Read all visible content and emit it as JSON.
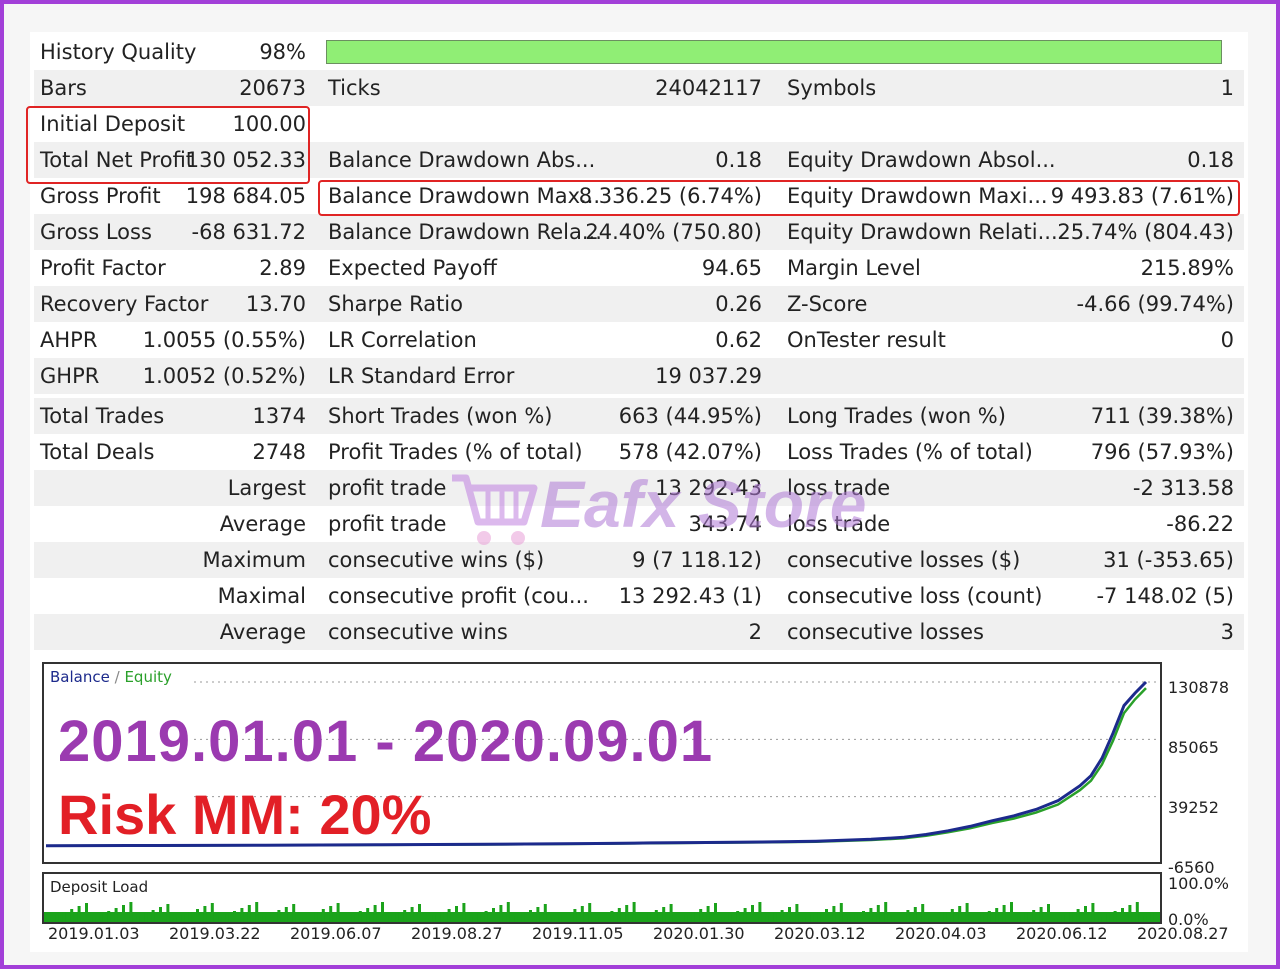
{
  "stats": {
    "history_quality": {
      "label": "History Quality",
      "value": "98%",
      "fill": 0.98
    },
    "rows1": [
      {
        "l1": "Bars",
        "v1": "20673",
        "l2": "Ticks",
        "v2": "24042117",
        "l3": "Symbols",
        "v3": "1"
      },
      {
        "l1": "Initial Deposit",
        "v1": "100.00",
        "l2": "",
        "v2": "",
        "l3": "",
        "v3": ""
      },
      {
        "l1": "Total Net Profit",
        "v1": "130 052.33",
        "l2": "Balance Drawdown Abs...",
        "v2": "0.18",
        "l3": "Equity Drawdown Absol...",
        "v3": "0.18"
      },
      {
        "l1": "Gross Profit",
        "v1": "198 684.05",
        "l2": "Balance Drawdown Max...",
        "v2": "8 336.25 (6.74%)",
        "l3": "Equity Drawdown Maxi...",
        "v3": "9 493.83 (7.61%)"
      },
      {
        "l1": "Gross Loss",
        "v1": "-68 631.72",
        "l2": "Balance Drawdown Rela...",
        "v2": "24.40% (750.80)",
        "l3": "Equity Drawdown Relati...",
        "v3": "25.74% (804.43)"
      },
      {
        "l1": "Profit Factor",
        "v1": "2.89",
        "l2": "Expected Payoff",
        "v2": "94.65",
        "l3": "Margin Level",
        "v3": "215.89%"
      },
      {
        "l1": "Recovery Factor",
        "v1": "13.70",
        "l2": "Sharpe Ratio",
        "v2": "0.26",
        "l3": "Z-Score",
        "v3": "-4.66 (99.74%)"
      },
      {
        "l1": "AHPR",
        "v1": "1.0055 (0.55%)",
        "l2": "LR Correlation",
        "v2": "0.62",
        "l3": "OnTester result",
        "v3": "0"
      },
      {
        "l1": "GHPR",
        "v1": "1.0052 (0.52%)",
        "l2": "LR Standard Error",
        "v2": "19 037.29",
        "l3": "",
        "v3": ""
      }
    ],
    "rows2": [
      {
        "l1": "Total Trades",
        "v1": "1374",
        "l2": "Short Trades (won %)",
        "v2": "663 (44.95%)",
        "l3": "Long Trades (won %)",
        "v3": "711 (39.38%)"
      },
      {
        "l1": "Total Deals",
        "v1": "2748",
        "l2": "Profit Trades (% of total)",
        "v2": "578 (42.07%)",
        "l3": "Loss Trades (% of total)",
        "v3": "796 (57.93%)"
      },
      {
        "l1": "",
        "v1": "Largest",
        "l2": "profit trade",
        "v2": "13 292.43",
        "l3": "loss trade",
        "v3": "-2 313.58"
      },
      {
        "l1": "",
        "v1": "Average",
        "l2": "profit trade",
        "v2": "343.74",
        "l3": "loss trade",
        "v3": "-86.22"
      },
      {
        "l1": "",
        "v1": "Maximum",
        "l2": "consecutive wins ($)",
        "v2": "9 (7 118.12)",
        "l3": "consecutive losses ($)",
        "v3": "31 (-353.65)"
      },
      {
        "l1": "",
        "v1": "Maximal",
        "l2": "consecutive profit (cou...",
        "v2": "13 292.43 (1)",
        "l3": "consecutive loss (count)",
        "v3": "-7 148.02 (5)"
      },
      {
        "l1": "",
        "v1": "Average",
        "l2": "consecutive wins",
        "v2": "2",
        "l3": "consecutive losses",
        "v3": "3"
      }
    ]
  },
  "watermark": {
    "text": "Eafx Store"
  },
  "chart_data": [
    {
      "type": "line",
      "legend": {
        "balance": "Balance",
        "separator": "/",
        "equity": "Equity"
      },
      "overlay": {
        "period": "2019.01.01 - 2020.09.01",
        "risk": "Risk MM: 20%"
      },
      "y_ticks": [
        "130878",
        "85065",
        "39252",
        "-6560"
      ],
      "ylim": [
        -6560,
        130878
      ],
      "x_ticks": [
        "2019.01.03",
        "2019.03.22",
        "2019.06.07",
        "2019.08.27",
        "2019.11.05",
        "2020.01.30",
        "2020.03.12",
        "2020.04.03",
        "2020.06.12",
        "2020.08.27"
      ],
      "series": [
        {
          "name": "Balance",
          "color": "#1c2a8c",
          "x": [
            0,
            0.1,
            0.2,
            0.3,
            0.4,
            0.5,
            0.55,
            0.6,
            0.65,
            0.7,
            0.75,
            0.78,
            0.8,
            0.82,
            0.84,
            0.86,
            0.88,
            0.9,
            0.92,
            0.94,
            0.95,
            0.96,
            0.97,
            0.98,
            0.99,
            1.0
          ],
          "y": [
            100,
            200,
            500,
            800,
            1200,
            1800,
            2300,
            2600,
            3000,
            3700,
            5200,
            6800,
            9000,
            12000,
            15500,
            20000,
            24000,
            29000,
            36000,
            48000,
            56000,
            70000,
            90000,
            112000,
            122000,
            130878
          ]
        },
        {
          "name": "Equity",
          "color": "#2aa02a",
          "x": [
            0,
            0.1,
            0.2,
            0.3,
            0.4,
            0.5,
            0.55,
            0.6,
            0.65,
            0.7,
            0.75,
            0.78,
            0.8,
            0.82,
            0.84,
            0.86,
            0.88,
            0.9,
            0.92,
            0.94,
            0.95,
            0.96,
            0.97,
            0.98,
            0.99,
            1.0
          ],
          "y": [
            90,
            180,
            450,
            700,
            1050,
            1600,
            2050,
            2350,
            2700,
            3300,
            4600,
            6000,
            8000,
            10800,
            14000,
            18200,
            21800,
            26500,
            33000,
            44500,
            52000,
            65000,
            84000,
            106000,
            117000,
            126000
          ]
        }
      ]
    },
    {
      "type": "bar",
      "title": "Deposit Load",
      "y_ticks": [
        "100.0%",
        "0.0%"
      ],
      "ylim": [
        0,
        100
      ],
      "color": "#1ba31b"
    }
  ]
}
